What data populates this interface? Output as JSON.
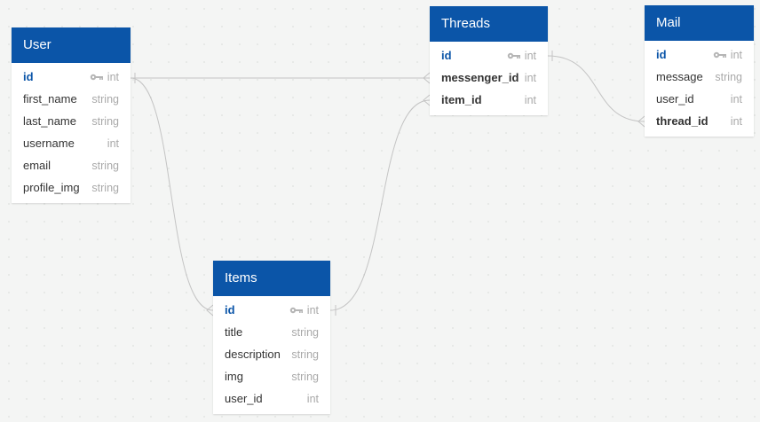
{
  "tables": [
    {
      "name": "User",
      "fields": [
        {
          "name": "id",
          "type": "int",
          "pk": true
        },
        {
          "name": "first_name",
          "type": "string"
        },
        {
          "name": "last_name",
          "type": "string"
        },
        {
          "name": "username",
          "type": "int"
        },
        {
          "name": "email",
          "type": "string"
        },
        {
          "name": "profile_img",
          "type": "string"
        }
      ]
    },
    {
      "name": "Threads",
      "fields": [
        {
          "name": "id",
          "type": "int",
          "pk": true
        },
        {
          "name": "messenger_id",
          "type": "int",
          "bold": true
        },
        {
          "name": "item_id",
          "type": "int",
          "bold": true
        }
      ]
    },
    {
      "name": "Mail",
      "fields": [
        {
          "name": "id",
          "type": "int",
          "pk": true
        },
        {
          "name": "message",
          "type": "string"
        },
        {
          "name": "user_id",
          "type": "int"
        },
        {
          "name": "thread_id",
          "type": "int",
          "bold": true
        }
      ]
    },
    {
      "name": "Items",
      "fields": [
        {
          "name": "id",
          "type": "int",
          "pk": true
        },
        {
          "name": "title",
          "type": "string"
        },
        {
          "name": "description",
          "type": "string"
        },
        {
          "name": "img",
          "type": "string"
        },
        {
          "name": "user_id",
          "type": "int"
        }
      ]
    }
  ],
  "colors": {
    "header": "#0b55a8",
    "pk": "#0b55a8",
    "link": "#c4c4c4"
  }
}
